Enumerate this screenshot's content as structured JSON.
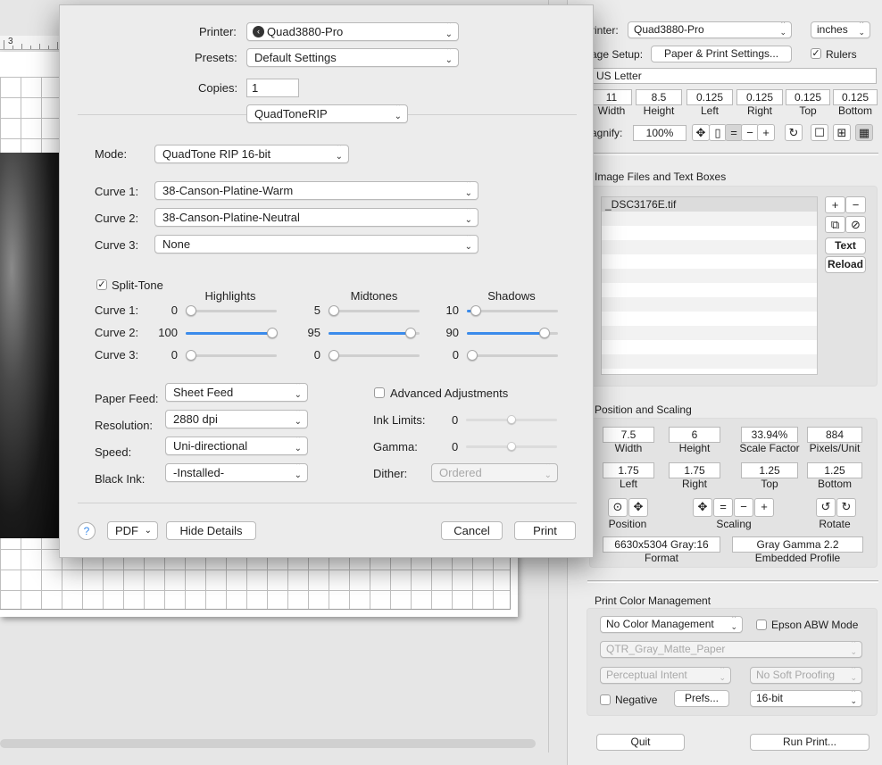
{
  "canvas": {
    "ruler_number": "3"
  },
  "panel": {
    "printer_label": "rinter:",
    "printer_value": "Quad3880-Pro",
    "units_value": "inches",
    "page_setup_label": "age Setup:",
    "page_setup_button": "Paper & Print Settings...",
    "rulers_label": "Rulers",
    "rulers_checked": "✓",
    "paper_name": "US Letter",
    "paper_fields": [
      {
        "value": "11",
        "label": "Width"
      },
      {
        "value": "8.5",
        "label": "Height"
      },
      {
        "value": "0.125",
        "label": "Left"
      },
      {
        "value": "0.125",
        "label": "Right"
      },
      {
        "value": "0.125",
        "label": "Top"
      },
      {
        "value": "0.125",
        "label": "Bottom"
      }
    ],
    "magnify_label": "agnify:",
    "magnify_value": "100%",
    "magnify_icons": [
      "move-icon",
      "page-icon",
      "equals-icon",
      "minus-icon",
      "plus-icon",
      "rotate-icon",
      "single-view-icon",
      "quad-grid-icon",
      "fine-grid-icon"
    ],
    "files_title": "Image Files and Text Boxes",
    "files": [
      "_DSC3176E.tif"
    ],
    "files_buttons": {
      "add": "+",
      "remove": "−",
      "text": "Text",
      "reload": "Reload"
    },
    "position_title": "Position and Scaling",
    "size_fields": [
      {
        "value": "7.5",
        "label": "Width"
      },
      {
        "value": "6",
        "label": "Height"
      },
      {
        "value": "33.94%",
        "label": "Scale Factor"
      },
      {
        "value": "884",
        "label": "Pixels/Unit"
      }
    ],
    "margin_fields": [
      {
        "value": "1.75",
        "label": "Left"
      },
      {
        "value": "1.75",
        "label": "Right"
      },
      {
        "value": "1.25",
        "label": "Top"
      },
      {
        "value": "1.25",
        "label": "Bottom"
      }
    ],
    "position_label": "Position",
    "scaling_label": "Scaling",
    "rotate_label": "Rotate",
    "scaling_symbols": {
      "equals": "=",
      "minus": "−",
      "plus": "+"
    },
    "format_value": "6630x5304 Gray:16",
    "format_label": "Format",
    "profile_value": "Gray Gamma 2.2",
    "profile_label": "Embedded Profile",
    "color_title": "Print Color Management",
    "color_mgmt_value": "No Color Management",
    "epson_abw_label": "Epson ABW Mode",
    "paper_profile_value": "QTR_Gray_Matte_Paper",
    "intent_value": "Perceptual Intent",
    "proofing_value": "No Soft Proofing",
    "negative_label": "Negative",
    "prefs_button": "Prefs...",
    "bitdepth_value": "16-bit",
    "quit_button": "Quit",
    "run_print_button": "Run Print..."
  },
  "dialog": {
    "printer_label": "Printer:",
    "printer_value": "Quad3880-Pro",
    "presets_label": "Presets:",
    "presets_value": "Default Settings",
    "copies_label": "Copies:",
    "copies_value": "1",
    "pane_value": "QuadToneRIP",
    "mode_label": "Mode:",
    "mode_value": "QuadTone RIP 16-bit",
    "curve1_label": "Curve 1:",
    "curve1_value": "38-Canson-Platine-Warm",
    "curve2_label": "Curve 2:",
    "curve2_value": "38-Canson-Platine-Neutral",
    "curve3_label": "Curve 3:",
    "curve3_value": "None",
    "split_tone_label": "Split-Tone",
    "split_tone_checked": "✓",
    "column_headers": [
      "Highlights",
      "Midtones",
      "Shadows"
    ],
    "split_rows": [
      {
        "label": "Curve 1:",
        "values": [
          0,
          5,
          10
        ],
        "fractions": [
          0,
          0.04,
          0.1
        ]
      },
      {
        "label": "Curve 2:",
        "values": [
          100,
          95,
          90
        ],
        "fractions": [
          0.95,
          0.9,
          0.85
        ]
      },
      {
        "label": "Curve 3:",
        "values": [
          0,
          0,
          0
        ],
        "fractions": [
          0,
          0,
          0
        ]
      }
    ],
    "paper_feed_label": "Paper Feed:",
    "paper_feed_value": "Sheet Feed",
    "resolution_label": "Resolution:",
    "resolution_value": "2880 dpi",
    "speed_label": "Speed:",
    "speed_value": "Uni-directional",
    "black_ink_label": "Black Ink:",
    "black_ink_value": "-Installed-",
    "advanced_label": "Advanced Adjustments",
    "ink_limits_label": "Ink Limits:",
    "ink_limits_value": "0",
    "ink_limits_fraction": 0.5,
    "gamma_label": "Gamma:",
    "gamma_value": "0",
    "gamma_fraction": 0.5,
    "dither_label": "Dither:",
    "dither_value": "Ordered",
    "help_label": "?",
    "pdf_button": "PDF",
    "hide_details_button": "Hide Details",
    "cancel_button": "Cancel",
    "print_button": "Print"
  }
}
